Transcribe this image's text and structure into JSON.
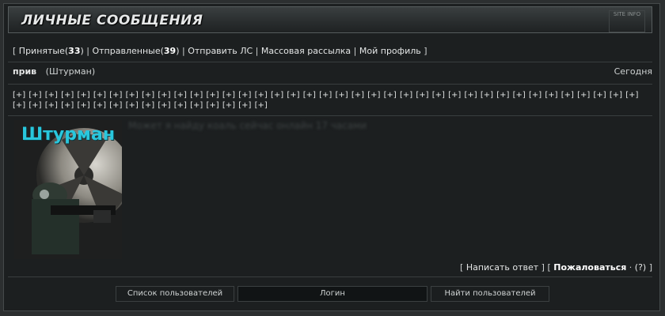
{
  "header": {
    "title": "ЛИЧНЫЕ СООБЩЕНИЯ",
    "tag": "SITE INFO"
  },
  "nav": {
    "open_bracket": "[",
    "inbox_label": "Принятые",
    "inbox_count": "33",
    "sent_label": "Отправленные",
    "sent_count": "39",
    "send_label": "Отправить ЛС",
    "mass_label": "Массовая рассылка",
    "profile_label": "Мой профиль",
    "close_bracket": "]"
  },
  "message": {
    "subject": "прив",
    "sender": "(Штурман)",
    "date": "Сегодня",
    "plus_label": "[+]",
    "plus_count": 55,
    "avatar_name": "Штурман",
    "body": "Может я найду коаль сейчас онлайн 17 часами"
  },
  "actions": {
    "reply": "Написать ответ",
    "report": "Пожаловаться",
    "help": "(?)"
  },
  "footer": {
    "users_list": "Список пользователей",
    "login_placeholder": "Логин",
    "find_users": "Найти пользователей"
  }
}
